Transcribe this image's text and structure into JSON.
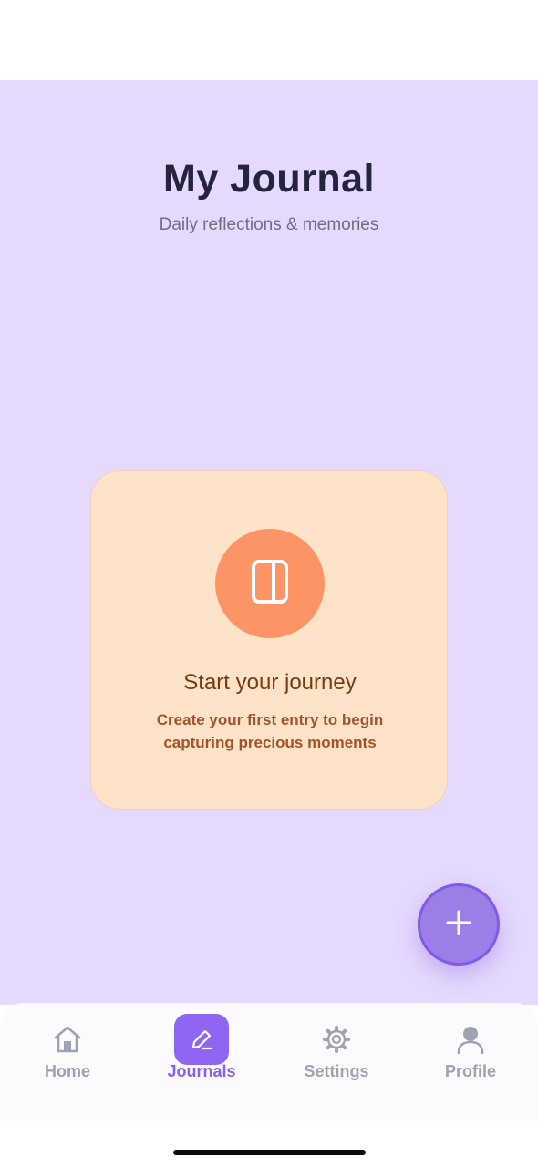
{
  "header": {
    "title": "My Journal",
    "subtitle": "Daily reflections & memories"
  },
  "empty_state": {
    "icon": "book-icon",
    "title": "Start your journey",
    "message": "Create your first entry to begin capturing precious moments"
  },
  "fab": {
    "icon": "plus-icon"
  },
  "tab_bar": {
    "items": [
      {
        "label": "Home",
        "icon": "home-icon",
        "active": false
      },
      {
        "label": "Journals",
        "icon": "pencil-icon",
        "active": true
      },
      {
        "label": "Settings",
        "icon": "gear-icon",
        "active": false
      },
      {
        "label": "Profile",
        "icon": "person-icon",
        "active": false
      }
    ]
  },
  "colors": {
    "background": "#e5d9fe",
    "card": "#fee3c9",
    "accent": "#8e66f1",
    "icon_circle": "#fd9466",
    "inactive_tab": "#9ea3b2"
  }
}
